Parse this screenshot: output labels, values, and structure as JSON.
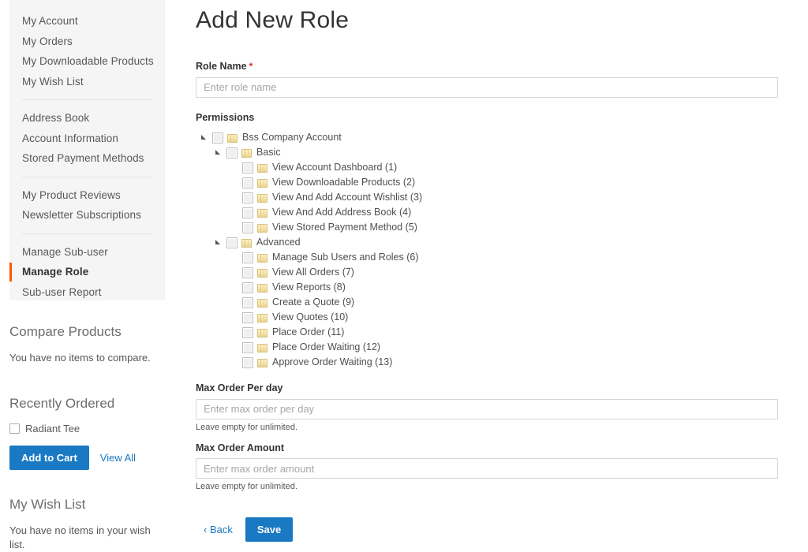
{
  "sidebar": {
    "nav_groups": [
      {
        "items": [
          {
            "label": "My Account",
            "current": false
          },
          {
            "label": "My Orders",
            "current": false
          },
          {
            "label": "My Downloadable Products",
            "current": false
          },
          {
            "label": "My Wish List",
            "current": false
          }
        ]
      },
      {
        "items": [
          {
            "label": "Address Book",
            "current": false
          },
          {
            "label": "Account Information",
            "current": false
          },
          {
            "label": "Stored Payment Methods",
            "current": false
          }
        ]
      },
      {
        "items": [
          {
            "label": "My Product Reviews",
            "current": false
          },
          {
            "label": "Newsletter Subscriptions",
            "current": false
          }
        ]
      },
      {
        "items": [
          {
            "label": "Manage Sub-user",
            "current": false
          },
          {
            "label": "Manage Role",
            "current": true
          },
          {
            "label": "Sub-user Report",
            "current": false
          }
        ]
      }
    ],
    "compare": {
      "title": "Compare Products",
      "empty_text": "You have no items to compare."
    },
    "recently_ordered": {
      "title": "Recently Ordered",
      "items": [
        {
          "label": "Radiant Tee",
          "checked": false
        }
      ],
      "add_to_cart_label": "Add to Cart",
      "view_all_label": "View All"
    },
    "wishlist": {
      "title": "My Wish List",
      "empty_text": "You have no items in your wish list."
    }
  },
  "main": {
    "page_title": "Add New Role",
    "role_name": {
      "label": "Role Name",
      "required_marker": "*",
      "value": "",
      "placeholder": "Enter role name"
    },
    "permissions": {
      "label": "Permissions",
      "tree": [
        {
          "level": 0,
          "label": "Bss Company Account",
          "expandable": true,
          "expanded": true,
          "checked": false
        },
        {
          "level": 1,
          "label": "Basic",
          "expandable": true,
          "expanded": true,
          "checked": false
        },
        {
          "level": 2,
          "label": "View Account Dashboard (1)",
          "expandable": false,
          "expanded": false,
          "checked": false
        },
        {
          "level": 2,
          "label": "View Downloadable Products (2)",
          "expandable": false,
          "expanded": false,
          "checked": false
        },
        {
          "level": 2,
          "label": "View And Add Account Wishlist (3)",
          "expandable": false,
          "expanded": false,
          "checked": false
        },
        {
          "level": 2,
          "label": "View And Add Address Book (4)",
          "expandable": false,
          "expanded": false,
          "checked": false
        },
        {
          "level": 2,
          "label": "View Stored Payment Method (5)",
          "expandable": false,
          "expanded": false,
          "checked": false
        },
        {
          "level": 1,
          "label": "Advanced",
          "expandable": true,
          "expanded": true,
          "checked": false
        },
        {
          "level": 2,
          "label": "Manage Sub Users and Roles (6)",
          "expandable": false,
          "expanded": false,
          "checked": false
        },
        {
          "level": 2,
          "label": "View All Orders (7)",
          "expandable": false,
          "expanded": false,
          "checked": false
        },
        {
          "level": 2,
          "label": "View Reports (8)",
          "expandable": false,
          "expanded": false,
          "checked": false
        },
        {
          "level": 2,
          "label": "Create a Quote (9)",
          "expandable": false,
          "expanded": false,
          "checked": false
        },
        {
          "level": 2,
          "label": "View Quotes (10)",
          "expandable": false,
          "expanded": false,
          "checked": false
        },
        {
          "level": 2,
          "label": "Place Order (11)",
          "expandable": false,
          "expanded": false,
          "checked": false
        },
        {
          "level": 2,
          "label": "Place Order Waiting (12)",
          "expandable": false,
          "expanded": false,
          "checked": false
        },
        {
          "level": 2,
          "label": "Approve Order Waiting (13)",
          "expandable": false,
          "expanded": false,
          "checked": false
        }
      ]
    },
    "max_order_per_day": {
      "label": "Max Order Per day",
      "value": "",
      "placeholder": "Enter max order per day",
      "note": "Leave empty for unlimited."
    },
    "max_order_amount": {
      "label": "Max Order Amount",
      "value": "",
      "placeholder": "Enter max order amount",
      "note": "Leave empty for unlimited."
    },
    "back_label": "Back",
    "back_chevron": "‹",
    "save_label": "Save"
  },
  "colors": {
    "accent_blue": "#1979c3",
    "active_orange": "#ff5501",
    "required_red": "#e02b27",
    "panel_gray": "#f5f5f5"
  }
}
